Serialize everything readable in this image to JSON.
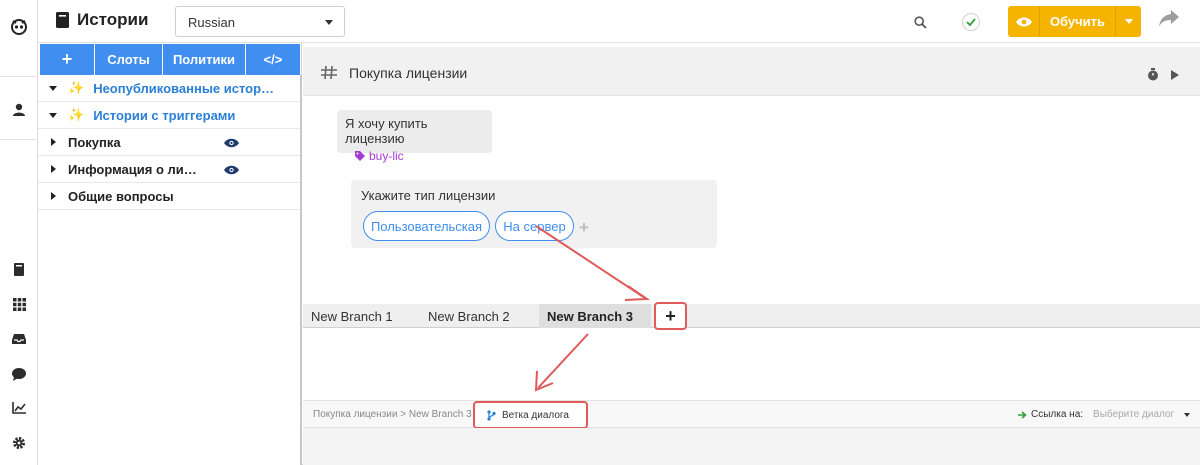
{
  "header": {
    "title": "Истории",
    "language": "Russian",
    "train_label": "Обучить",
    "colors": {
      "train": "#f5b400",
      "accent": "#3f8ef0",
      "annotation": "#e05a5a",
      "check": "#2e9e3e"
    }
  },
  "rail": {
    "icons": [
      "logo-icon",
      "user-icon",
      "book-icon",
      "grid-icon",
      "inbox-icon",
      "chat-icon",
      "chart-icon",
      "gear-icon"
    ]
  },
  "sidebar": {
    "toolbar": {
      "add": "+",
      "slots": "Слоты",
      "policies": "Политики",
      "code": "</>"
    },
    "items": [
      {
        "label": "Неопубликованные истор…",
        "expanded": true,
        "sparkle": true
      },
      {
        "label": "Истории с триггерами",
        "expanded": true,
        "sparkle": true
      },
      {
        "label": "Покупка",
        "expanded": false,
        "eye": true
      },
      {
        "label": "Информация о ли…",
        "expanded": false,
        "eye": true
      },
      {
        "label": "Общие вопросы",
        "expanded": false
      }
    ]
  },
  "story": {
    "title": "Покупка лицензии",
    "user_text": "Я хочу купить лицензию",
    "intent": "buy-lic",
    "bot_text": "Укажите тип лицензии",
    "quick_replies": [
      "Пользовательская",
      "На сервер"
    ]
  },
  "tabs": [
    "New Branch 1",
    "New Branch 2",
    "New Branch 3"
  ],
  "active_tab": "New Branch 3",
  "footer": {
    "breadcrumb": "Покупка лицензии > New Branch 3",
    "branch_label": "Ветка диалога",
    "link_label": "Ссылка на:",
    "link_placeholder": "Выберите диалог"
  }
}
